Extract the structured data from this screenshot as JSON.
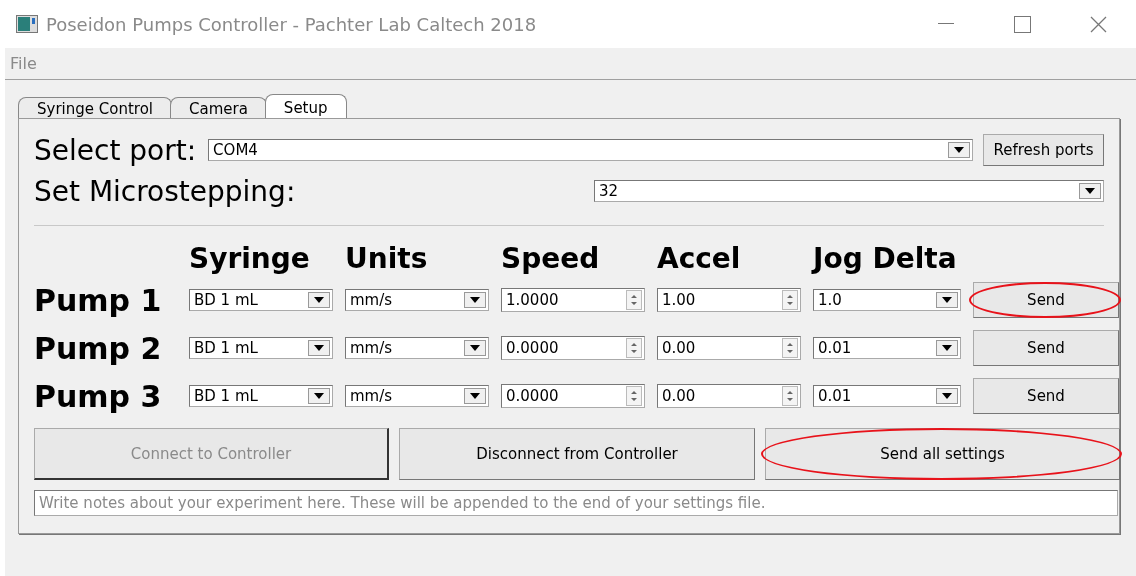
{
  "window": {
    "title": "Poseidon Pumps Controller - Pachter Lab Caltech 2018"
  },
  "menu": [
    "File"
  ],
  "tabs": [
    {
      "label": "Syringe Control",
      "selected": false
    },
    {
      "label": "Camera",
      "selected": false
    },
    {
      "label": "Setup",
      "selected": true
    }
  ],
  "port": {
    "label": "Select port:",
    "value": "COM4",
    "button": "Refresh ports"
  },
  "microstepping": {
    "label": "Set Microstepping:",
    "value": "32"
  },
  "columns": [
    "Syringe",
    "Units",
    "Speed",
    "Accel",
    "Jog Delta"
  ],
  "pumps": [
    {
      "name": "Pump 1",
      "syringe": "BD 1 mL",
      "units": "mm/s",
      "speed": "1.0000",
      "accel": "1.00",
      "jog_delta": "1.0",
      "button": "Send",
      "highlighted": true
    },
    {
      "name": "Pump 2",
      "syringe": "BD 1 mL",
      "units": "mm/s",
      "speed": "0.0000",
      "accel": "0.00",
      "jog_delta": "0.01",
      "button": "Send",
      "highlighted": false
    },
    {
      "name": "Pump 3",
      "syringe": "BD 1 mL",
      "units": "mm/s",
      "speed": "0.0000",
      "accel": "0.00",
      "jog_delta": "0.01",
      "button": "Send",
      "highlighted": false
    }
  ],
  "actions": [
    {
      "label": "Connect to Controller",
      "disabled": true,
      "highlighted": false
    },
    {
      "label": "Disconnect from Controller",
      "disabled": false,
      "highlighted": false
    },
    {
      "label": "Send all settings",
      "disabled": false,
      "highlighted": true
    }
  ],
  "notes": {
    "placeholder": "Write notes about your experiment here. These will be appended to the end of your settings file."
  }
}
